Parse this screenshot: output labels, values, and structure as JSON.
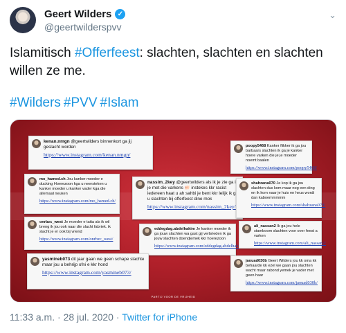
{
  "author": {
    "name": "Geert Wilders",
    "handle": "@geertwilderspvv",
    "verified_icon": "verified-badge-icon",
    "menu_icon": "chevron-down-icon"
  },
  "tweet": {
    "text_before": "Islamitisch ",
    "hashtag_inline": "#Offerfeest",
    "text_after": ": slachten, slachten en slachten willen ze me.",
    "hashtags": [
      "#Wilders",
      "#PVV",
      "#Islam"
    ]
  },
  "media": {
    "footer": "PARTIJ VOOR DE VRIJHEID",
    "cards": [
      {
        "user": "kenan.nmgn",
        "text": "@geertwilders binnenkort ga jij geslacht worden",
        "link": "https://www.instagram.com/kenan.nmgn/"
      },
      {
        "user": "poopy5468",
        "text": "Kanker flikker ik ga jou barbaars slachten ik ga je kanker hoere varken die je je moeder noemt baalen",
        "link": "https://www.instagram.com/poopy5468/"
      },
      {
        "user": "mo_hamed.ch",
        "text": "Jou kanker moeder e ducking Hoerezoon kga u neersteken u kanker moeder u kanker vader kga die allemaal neuken",
        "link": "https://www.instagram.com/mo_hamed.ch/"
      },
      {
        "user": "nassim_2key",
        "text": "@geertwilders als ik je zie ga ik je met die varkens 🐖 instekes kkr racist iedereen haat u ah sahbi je bent kkr lelijk ik ga u slachten bij offerfeest dine mok",
        "link": "https://www.instagram.com/nassim_2key/"
      },
      {
        "user": "shahzana070",
        "text": "Je kop ik ga jou slachten dus kom maar nog een ding en ik kom naar je huis en heus wordt dan kaboemmmmm",
        "link": "https://www.instagram.com/shahzana070/"
      },
      {
        "user": "onrbzc_west",
        "text": "Je moeder e tatta als ik wil breng ik jou ook naar die slacht fabriek. ik slacht je er ook bij vriend",
        "link": "https://www.instagram.com/onrbzc_west/"
      },
      {
        "user": "eddegdag.abdelhakim",
        "text": "Je kanker moeder ik ga jouw slachten wa gast gij verbrieden ik ga jouw slachten doendjemek kkr hoerezoon",
        "link": "https://www.instagram.com/eddegdag.abdelhakim/"
      },
      {
        "user": "ali_nassan2",
        "text": "Ik ga jou hele stamboom slachten voor over feest a varken",
        "link": "https://www.instagram.com/ali_nassan2/"
      },
      {
        "user": "yasmineb073",
        "text": "dit jaar gaan we geen schape slachte maar jou u behrijp ofni e kkr hond",
        "link": "https://www.instagram.com/yasmineb073/"
      },
      {
        "user": "jaouad030b",
        "text": "Geert Wilders jou kk oma kk behaarde kk ezel we gaan jou slachten wacht maar rabond yemek je vader met geen haar",
        "link": "https://www.instagram.com/jaouad030b/"
      }
    ]
  },
  "meta": {
    "time": "11:33 a.m.",
    "sep1": " · ",
    "date": "28 jul. 2020",
    "sep2": " · ",
    "source": "Twitter for iPhone"
  }
}
